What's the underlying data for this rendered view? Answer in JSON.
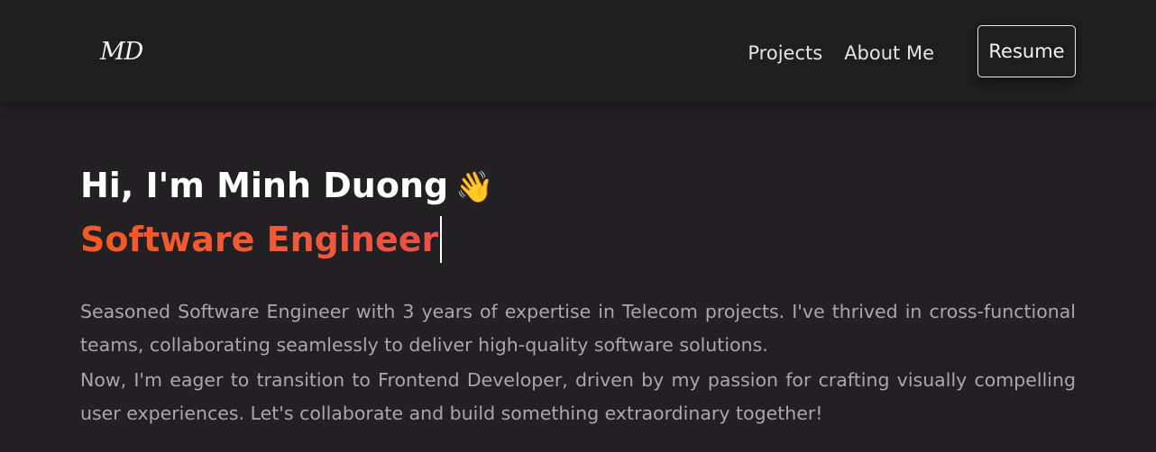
{
  "nav": {
    "logo": "MD",
    "links": [
      "Projects",
      "About Me"
    ],
    "resume_label": "Resume"
  },
  "hero": {
    "greeting": "Hi, I'm Minh Duong",
    "wave_emoji": "👋",
    "role": "Software Engineer",
    "bio_1": "Seasoned Software Engineer with 3 years of expertise in Telecom projects. I've thrived in cross-functional teams, collaborating seamlessly to deliver high-quality software solutions.",
    "bio_2": "Now, I'm eager to transition to Frontend Developer, driven by my passion for crafting visually compelling user experiences. Let's collaborate and build something extraordinary together!"
  },
  "colors": {
    "background": "#222022",
    "navbar": "#1f1e1f",
    "accent": "#f25a24",
    "body_text": "#a9a7a9"
  }
}
